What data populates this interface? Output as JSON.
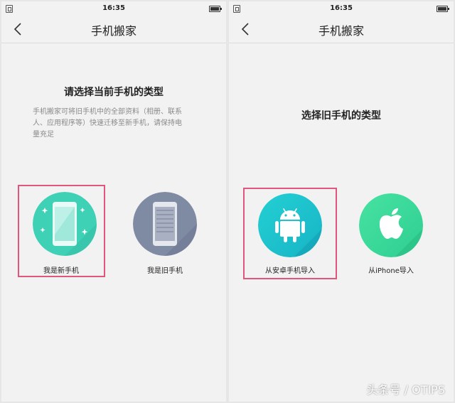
{
  "left": {
    "status": {
      "time": "16:35"
    },
    "nav": {
      "title": "手机搬家"
    },
    "heading": "请选择当前手机的类型",
    "description": [
      "手机搬家可将旧手机中的全部资料（相册、联系",
      "人、应用程序等）快速迁移至新手机，请保持电",
      "量充足"
    ],
    "options": [
      {
        "label": "我是新手机",
        "icon": "new-phone-icon",
        "color": "#3fd1b6"
      },
      {
        "label": "我是旧手机",
        "icon": "old-phone-icon",
        "color": "#7f8aa3"
      }
    ]
  },
  "right": {
    "status": {
      "time": "16:35"
    },
    "nav": {
      "title": "手机搬家"
    },
    "heading": "选择旧手机的类型",
    "options": [
      {
        "label": "从安卓手机导入",
        "icon": "android-icon",
        "color": "#1fc3cc"
      },
      {
        "label": "从iPhone导入",
        "icon": "apple-icon",
        "color": "#3cdb9a"
      }
    ]
  },
  "colors": {
    "highlight": "#e2567e",
    "background": "#f2f2f2"
  },
  "watermark": "头条号 / OTIPS"
}
